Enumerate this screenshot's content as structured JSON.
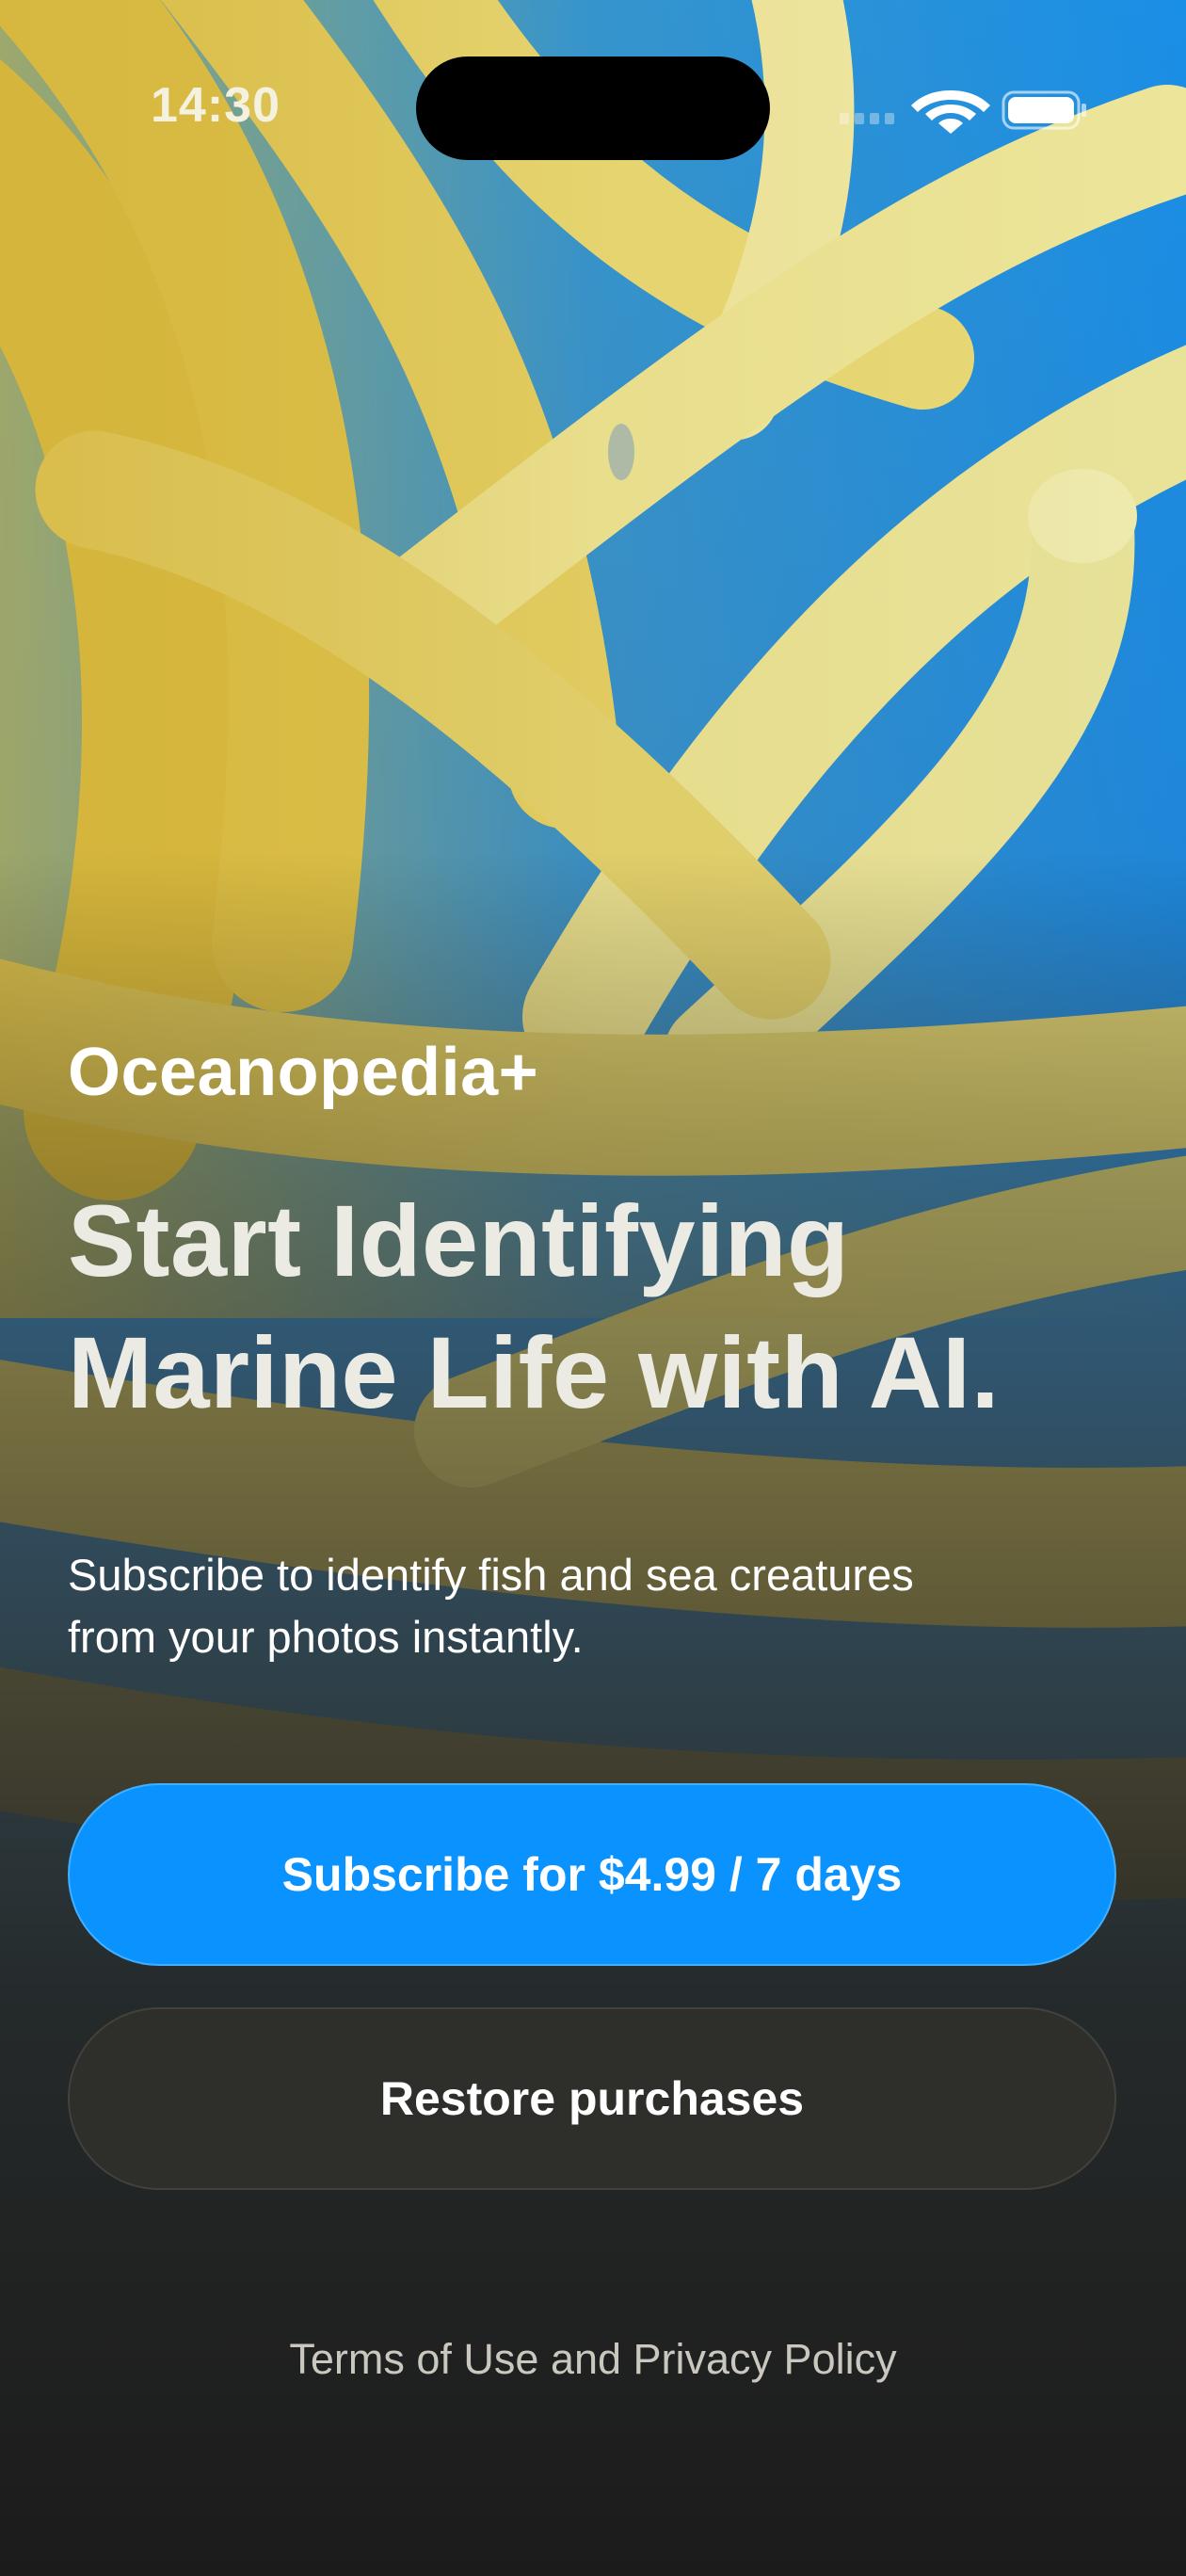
{
  "status_bar": {
    "time": "14:30",
    "icons": [
      "cellular-signal-icon",
      "wifi-icon",
      "battery-icon"
    ]
  },
  "hero": {
    "brand": "Oceanopedia+",
    "headline_lines": [
      "Start Identifying",
      "Marine Life with AI."
    ],
    "subtitle_lines": [
      "Subscribe to identify fish and sea creatures",
      "from your photos instantly."
    ]
  },
  "actions": {
    "subscribe_label": "Subscribe for $4.99 / 7 days",
    "restore_label": "Restore purchases"
  },
  "footer": {
    "terms_label": "Terms of Use and Privacy Policy"
  },
  "colors": {
    "accent": "#0a93ff",
    "water": "#1e86d6",
    "tentacle": "#e8e2a8"
  }
}
